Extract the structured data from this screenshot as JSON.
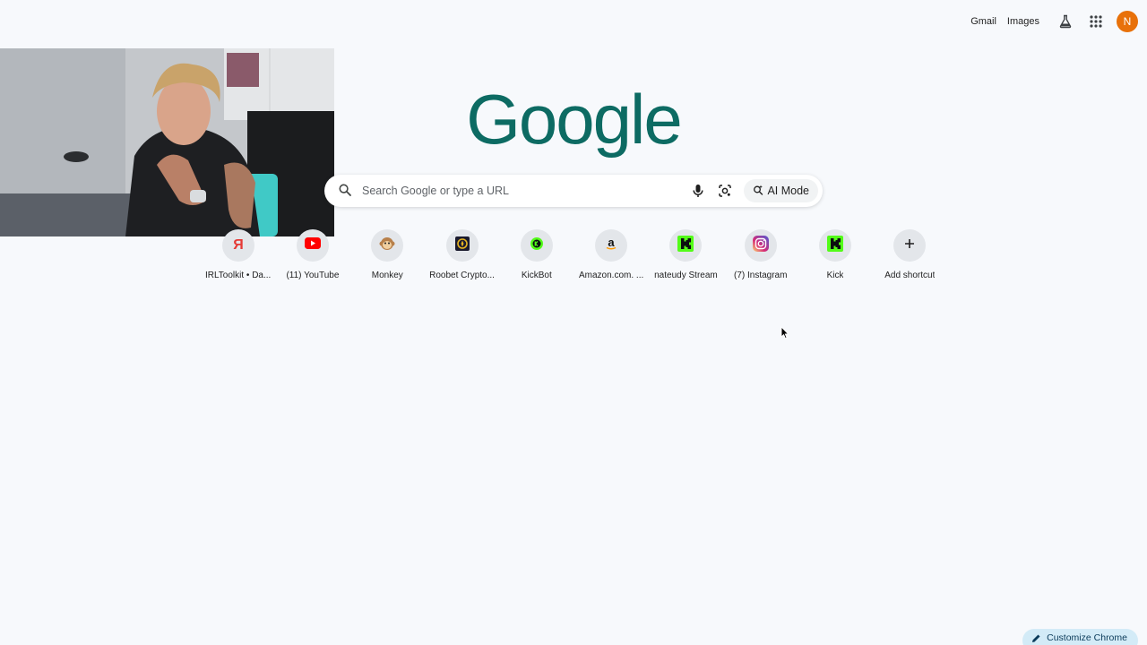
{
  "topbar": {
    "gmail_label": "Gmail",
    "images_label": "Images",
    "labs_icon": "flask-icon",
    "apps_icon": "apps-grid-icon",
    "avatar_initial": "N",
    "avatar_color": "#e8710a"
  },
  "logo": {
    "text": "Google",
    "color": "#0d6b63"
  },
  "search": {
    "placeholder": "Search Google or type a URL",
    "value": "",
    "ai_mode_label": "AI Mode"
  },
  "shortcuts": [
    {
      "label": "IRLToolkit • Da...",
      "icon": "irltoolkit-icon"
    },
    {
      "label": "(11) YouTube",
      "icon": "youtube-icon"
    },
    {
      "label": "Monkey",
      "icon": "monkey-icon"
    },
    {
      "label": "Roobet Crypto...",
      "icon": "roobet-icon"
    },
    {
      "label": "KickBot",
      "icon": "kickbot-icon"
    },
    {
      "label": "Amazon.com. ...",
      "icon": "amazon-icon"
    },
    {
      "label": "nateudy Stream",
      "icon": "kick-icon"
    },
    {
      "label": "(7) Instagram",
      "icon": "instagram-icon"
    },
    {
      "label": "Kick",
      "icon": "kick-icon"
    },
    {
      "label": "Add shortcut",
      "icon": "plus-icon"
    }
  ],
  "customize": {
    "label": "Customize Chrome"
  },
  "colors": {
    "background": "#f7f9fc",
    "kick_green": "#53fc18",
    "youtube_red": "#ff0000"
  }
}
